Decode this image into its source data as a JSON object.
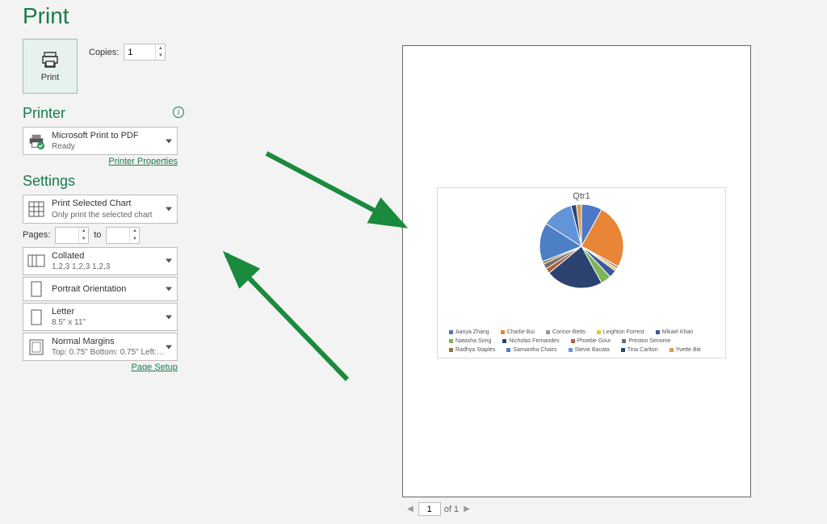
{
  "title": "Print",
  "print_button": "Print",
  "copies": {
    "label": "Copies:",
    "value": "1"
  },
  "printer": {
    "header": "Printer",
    "name": "Microsoft Print to PDF",
    "status": "Ready",
    "properties_link": "Printer Properties"
  },
  "settings": {
    "header": "Settings",
    "scope": {
      "main": "Print Selected Chart",
      "sub": "Only print the selected chart"
    },
    "pages": {
      "label": "Pages:",
      "from": "",
      "to_label": "to",
      "to": ""
    },
    "collate": {
      "main": "Collated",
      "sub": "1,2,3    1,2,3    1,2,3"
    },
    "orientation": {
      "main": "Portrait Orientation",
      "sub": ""
    },
    "paper": {
      "main": "Letter",
      "sub": "8.5\" x 11\""
    },
    "margins": {
      "main": "Normal Margins",
      "sub": "Top: 0.75\" Bottom: 0.75\" Left:…"
    },
    "page_setup_link": "Page Setup"
  },
  "nav": {
    "page": "1",
    "of_label": "of 1"
  },
  "chart_data": {
    "type": "pie",
    "title": "Qtr1",
    "series": [
      {
        "name": "Aanya Zhang",
        "value": 8,
        "color": "#4c78c5"
      },
      {
        "name": "Charlie Bui",
        "value": 25,
        "color": "#e98536"
      },
      {
        "name": "Connor Betts",
        "value": 1,
        "color": "#9a9a9a"
      },
      {
        "name": "Leighton Forrest",
        "value": 1,
        "color": "#f2c037"
      },
      {
        "name": "Mikael Khan",
        "value": 3,
        "color": "#3b5ba0"
      },
      {
        "name": "Natasha Song",
        "value": 4,
        "color": "#7db556"
      },
      {
        "name": "Nicholas Fernandes",
        "value": 22,
        "color": "#2b436e"
      },
      {
        "name": "Phoebe Gour",
        "value": 2,
        "color": "#a8643c"
      },
      {
        "name": "Preston Senome",
        "value": 2,
        "color": "#6e6e6e"
      },
      {
        "name": "Radhya Staples",
        "value": 1,
        "color": "#8e7a32"
      },
      {
        "name": "Samantha Chairs",
        "value": 15,
        "color": "#4d7fc4"
      },
      {
        "name": "Stevie Bacata",
        "value": 12,
        "color": "#6294d8"
      },
      {
        "name": "Tina Carlton",
        "value": 2,
        "color": "#294574"
      },
      {
        "name": "Yvette Biti",
        "value": 2,
        "color": "#d89a52"
      }
    ]
  }
}
